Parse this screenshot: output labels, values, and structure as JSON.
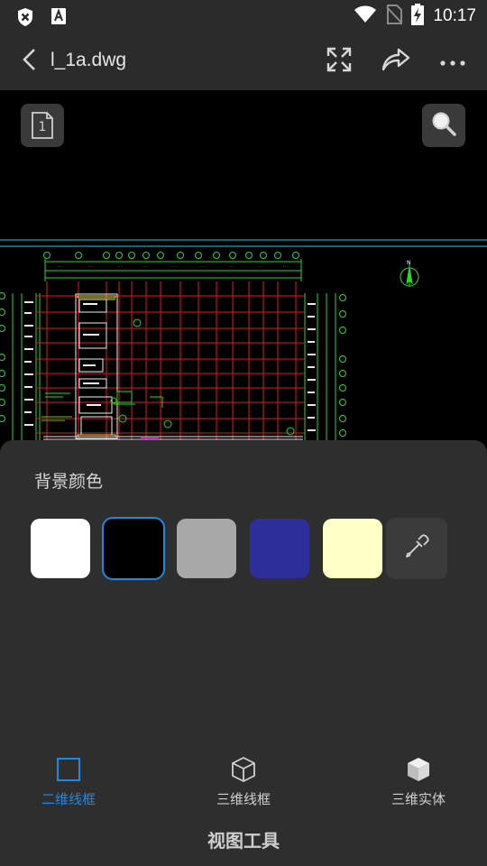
{
  "status": {
    "time": "10:17",
    "icons": [
      "shield-x-icon",
      "a-box-icon",
      "wifi-icon",
      "no-sim-icon",
      "battery-charging-icon"
    ]
  },
  "titlebar": {
    "filename": "l_1a.dwg",
    "icons": [
      "back-icon",
      "fullscreen-icon",
      "share-icon",
      "more-icon"
    ]
  },
  "canvas": {
    "layout_badge": "1",
    "icons": [
      "layout-icon",
      "search-icon"
    ]
  },
  "sheet": {
    "title": "背景颜色",
    "swatches": [
      {
        "name": "white",
        "color": "#ffffff",
        "selected": false
      },
      {
        "name": "black",
        "color": "#000000",
        "selected": true
      },
      {
        "name": "gray",
        "color": "#a8a8a8",
        "selected": false
      },
      {
        "name": "blue",
        "color": "#2e2e9a",
        "selected": false
      },
      {
        "name": "cream",
        "color": "#ffffc8",
        "selected": false
      }
    ],
    "picker_icon": "eyedropper-icon",
    "tabs": [
      {
        "label": "二维线框",
        "active": true,
        "icon": "square-outline-icon"
      },
      {
        "label": "三维线框",
        "active": false,
        "icon": "cube-wireframe-icon"
      },
      {
        "label": "三维实体",
        "active": false,
        "icon": "cube-solid-icon"
      }
    ],
    "footer": "视图工具"
  },
  "colors": {
    "accent": "#1e88e5",
    "panel": "#2e2e2e",
    "titlebar": "#2b2b2b",
    "cad_grid": "#e01b1b",
    "cad_lines": "#2bd62b",
    "cad_cyan": "#1ec8e6"
  }
}
